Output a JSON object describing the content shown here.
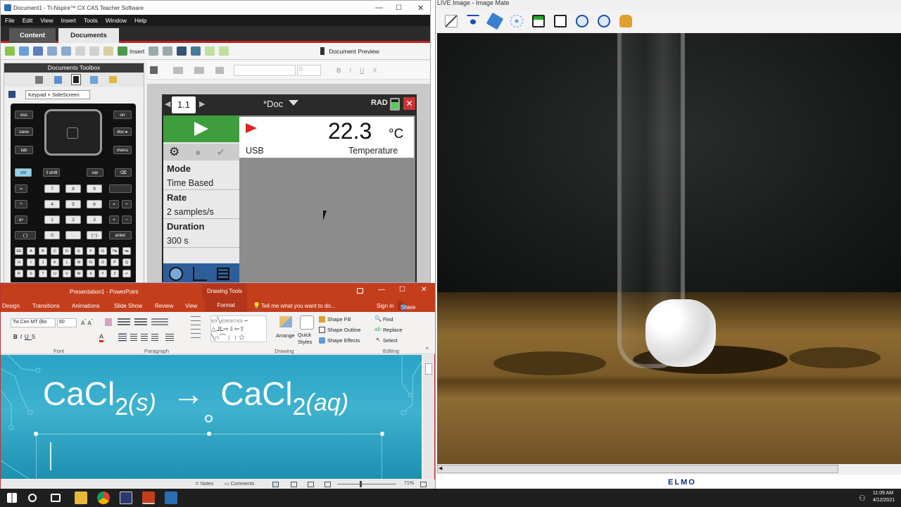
{
  "nspire": {
    "window_title": "Document1 - TI-Nspire™ CX CAS Teacher Software",
    "menu": [
      "File",
      "Edit",
      "View",
      "Insert",
      "Tools",
      "Window",
      "Help"
    ],
    "tabs": [
      "Content",
      "Documents"
    ],
    "toolbar": {
      "insert": "Insert",
      "doc_preview": "Document Preview"
    },
    "toolbox_title": "Documents Toolbox",
    "keypad_select": "Keypad + SideScreen",
    "font_size_value": "0",
    "format_letters": [
      "B",
      "I",
      "U",
      "X"
    ],
    "handheld": {
      "page_tab": "1.1",
      "doc_name": "*Doc",
      "mode_indicator": "RAD",
      "reading_value": "22.3",
      "reading_unit": "°C",
      "sensor_port": "USB",
      "sensor_name": "Temperature",
      "settings": [
        {
          "label": "Mode",
          "value": "Time Based"
        },
        {
          "label": "Rate",
          "value": "2 samples/s"
        },
        {
          "label": "Duration",
          "value": "300 s"
        }
      ]
    },
    "calc_keys": {
      "row1": [
        "esc",
        "on",
        "save",
        "doc ▸",
        "tab",
        "menu"
      ],
      "row_ctrl": [
        "ctrl",
        "⇧shift",
        "var",
        "⌫"
      ],
      "digits": [
        "7",
        "8",
        "9",
        "4",
        "5",
        "6",
        "1",
        "2",
        "3",
        "0",
        ".",
        "(−)"
      ],
      "ops": [
        "=",
        "^",
        "eˣ",
        "( )",
        "×",
        "÷",
        "+",
        "−",
        "enter"
      ],
      "letters": [
        "EE",
        "A",
        "B",
        "C",
        "D",
        "E",
        "F",
        "G",
        "?!▸",
        "π▸",
        "H",
        "I",
        "J",
        "K",
        "L",
        "M",
        "N",
        "O",
        "P",
        "Q",
        "R",
        "S",
        "T",
        "U",
        "V",
        "W",
        "X",
        "Y",
        "Z",
        "↵"
      ]
    }
  },
  "ppt": {
    "title": "Presentation1 - PowerPoint",
    "context_tool": "Drawing Tools",
    "tabs": [
      "Design",
      "Transitions",
      "Animations",
      "Slide Show",
      "Review",
      "View",
      "Format"
    ],
    "tell_me": "Tell me what you want to do...",
    "sign_in": "Sign in",
    "share": "Share",
    "font_name": "Tw Cen MT (Bo",
    "font_size": "60",
    "groups": [
      "Font",
      "Paragraph",
      "Drawing",
      "Editing"
    ],
    "drawing": {
      "arrange": "Arrange",
      "quick_styles": "Quick Styles",
      "shape_fill": "Shape Fill",
      "shape_outline": "Shape Outline",
      "shape_effects": "Shape Effects"
    },
    "editing": {
      "find": "Find",
      "replace": "Replace",
      "select": "Select"
    },
    "slide_equation": {
      "left": "CaCl",
      "sub_left": "2",
      "state_left": "(s)",
      "arrow": "→",
      "right": "CaCl",
      "sub_right": "2",
      "state_right": "(aq)"
    },
    "status": {
      "notes": "Notes",
      "comments": "Comments",
      "zoom": "71%"
    }
  },
  "imagemate": {
    "title": "LIVE Image - Image Mate",
    "brand": "ELMO",
    "tool_icons": [
      "line-icon",
      "point-icon",
      "pen-icon",
      "dots-icon",
      "save-icon",
      "fit-icon",
      "zoom-in-icon",
      "zoom-out-icon",
      "hand-icon"
    ]
  },
  "taskbar": {
    "time": "11:09 AM",
    "date": "4/12/2021"
  },
  "colors": {
    "ppt_accent": "#c43e1c",
    "nspire_red": "#c0201f",
    "play_green": "#3e9e3e",
    "slide_teal": "#2aa3c5"
  }
}
